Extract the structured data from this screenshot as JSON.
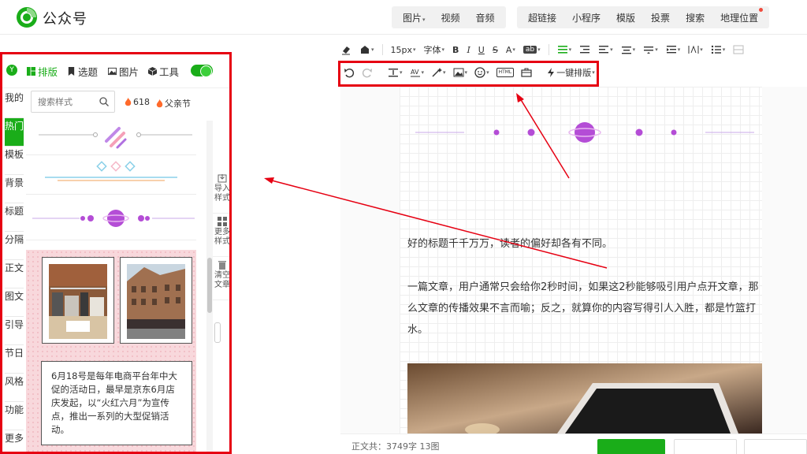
{
  "header": {
    "brand": "公众号",
    "media_items": [
      {
        "label": "图片",
        "has_caret": true
      },
      {
        "label": "视频",
        "has_caret": false
      },
      {
        "label": "音频",
        "has_caret": false
      }
    ],
    "feature_items": [
      {
        "label": "超链接"
      },
      {
        "label": "小程序"
      },
      {
        "label": "模版"
      },
      {
        "label": "投票"
      },
      {
        "label": "搜索"
      },
      {
        "label": "地理位置",
        "has_dot": true
      }
    ]
  },
  "left_panel": {
    "badge": "Y",
    "tabs": [
      {
        "label": "排版",
        "icon": "layout-icon",
        "active": true
      },
      {
        "label": "选题",
        "icon": "bookmark-icon",
        "active": false
      },
      {
        "label": "图片",
        "icon": "image-icon",
        "active": false
      },
      {
        "label": "工具",
        "icon": "cube-icon",
        "active": false
      }
    ],
    "toggle_on": true,
    "vertical_tabs": [
      {
        "label": "我的",
        "active": false
      },
      {
        "label": "热门",
        "active": true
      },
      {
        "label": "模板",
        "active": false
      },
      {
        "label": "背景",
        "active": false
      },
      {
        "label": "标题",
        "active": false
      },
      {
        "label": "分隔",
        "active": false
      },
      {
        "label": "正文",
        "active": false
      },
      {
        "label": "图文",
        "active": false
      },
      {
        "label": "引导",
        "active": false
      },
      {
        "label": "节日",
        "active": false
      },
      {
        "label": "风格",
        "active": false
      },
      {
        "label": "功能",
        "active": false
      },
      {
        "label": "更多",
        "active": false
      }
    ],
    "search": {
      "placeholder": "搜索样式",
      "value": ""
    },
    "hot_tags": [
      {
        "label": "618"
      },
      {
        "label": "父亲节"
      }
    ],
    "side_tools": [
      {
        "label": "导入样式",
        "icon": "import-icon"
      },
      {
        "label": "更多样式",
        "icon": "grid-icon"
      },
      {
        "label": "清空文章",
        "icon": "trash-icon"
      }
    ],
    "gallery_text": "6月18号是每年电商平台年中大促的活动日，最早是京东6月店庆发起，以“火红六月”为宣传点，推出一系列的大型促销活动。"
  },
  "toolbar": {
    "font_size": "15px",
    "font_family": "字体",
    "format_buttons": [
      "B",
      "I",
      "U",
      "S",
      "A"
    ],
    "bg_label": "ab",
    "one_click_layout": "一键排版",
    "html_label": "HTML"
  },
  "editor": {
    "paragraph_1": "好的标题千千万万，读者的偏好却各有不同。",
    "paragraph_2_line1": "一篇文章，用户通常只会给你2秒时间，如果这2秒能够吸引用户点开文章，那",
    "paragraph_2_line2": "么文章的传播效果不言而喻；反之，就算你的内容写得引人入胜，都是竹篮打",
    "paragraph_2_line3": "水。"
  },
  "status": {
    "text": "正文共：3749字 13图"
  },
  "colors": {
    "brand_green": "#1aad19",
    "highlight_red": "#e60012",
    "divider_purple": "#b44dd6"
  }
}
